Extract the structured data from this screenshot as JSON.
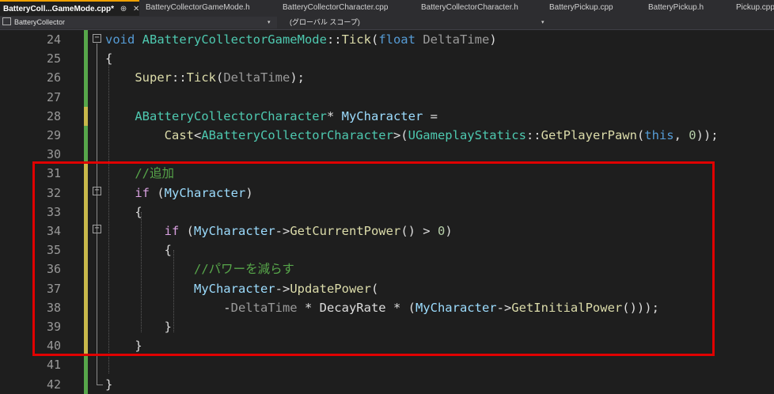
{
  "tabs": [
    {
      "label": "BatteryColl...GameMode.cpp*",
      "active": true,
      "pin": "⊕",
      "close": "✕"
    },
    {
      "label": "BatteryCollectorGameMode.h"
    },
    {
      "label": "BatteryCollectorCharacter.cpp"
    },
    {
      "label": "BatteryCollectorCharacter.h"
    },
    {
      "label": "BatteryPickup.cpp"
    },
    {
      "label": "BatteryPickup.h"
    },
    {
      "label": "Pickup.cpp"
    }
  ],
  "navbar": {
    "project": "BatteryCollector",
    "scope": "(グローバル スコープ)",
    "dropdown_arrow": "▾"
  },
  "editor": {
    "line_numbers": [
      "24",
      "25",
      "26",
      "27",
      "28",
      "29",
      "30",
      "31",
      "32",
      "33",
      "34",
      "35",
      "36",
      "37",
      "38",
      "39",
      "40",
      "41",
      "42"
    ],
    "fold_glyph": "−",
    "lines": [
      "void ABatteryCollectorGameMode::Tick(float DeltaTime)",
      "{",
      "    Super::Tick(DeltaTime);",
      "",
      "    ABatteryCollectorCharacter* MyCharacter =",
      "        Cast<ABatteryCollectorCharacter>(UGameplayStatics::GetPlayerPawn(this, 0));",
      "",
      "    //追加",
      "    if (MyCharacter)",
      "    {",
      "        if (MyCharacter->GetCurrentPower() > 0)",
      "        {",
      "            //パワーを減らす",
      "            MyCharacter->UpdatePower(",
      "                -DeltaTime * DecayRate * (MyCharacter->GetInitialPower()));",
      "        }",
      "    }",
      "",
      "}"
    ]
  }
}
